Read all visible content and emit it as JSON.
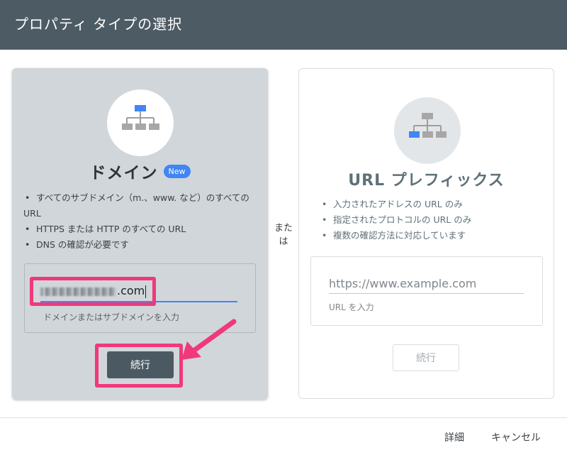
{
  "dialog": {
    "title": "プロパティ タイプの選択"
  },
  "domain_card": {
    "title": "ドメイン",
    "badge": "New",
    "features": [
      "すべてのサブドメイン（m.、www. など）のすべての URL",
      "HTTPS または HTTP のすべての URL",
      "DNS の確認が必要です"
    ],
    "input_visible_value": ".com",
    "input_helper": "ドメインまたはサブドメインを入力",
    "continue_label": "続行",
    "icon": "sitemap-icon",
    "accent_color": "#4285f4"
  },
  "separator": {
    "label_line1": "また",
    "label_line2": "は"
  },
  "url_card": {
    "title": "URL プレフィックス",
    "features": [
      "入力されたアドレスの URL のみ",
      "指定されたプロトコルの URL のみ",
      "複数の確認方法に対応しています"
    ],
    "input_placeholder": "https://www.example.com",
    "input_helper": "URL を入力",
    "continue_label": "続行",
    "icon": "sitemap-icon"
  },
  "footer": {
    "details_label": "詳細",
    "cancel_label": "キャンセル"
  },
  "annotations": {
    "highlight_color": "#f0397a"
  }
}
